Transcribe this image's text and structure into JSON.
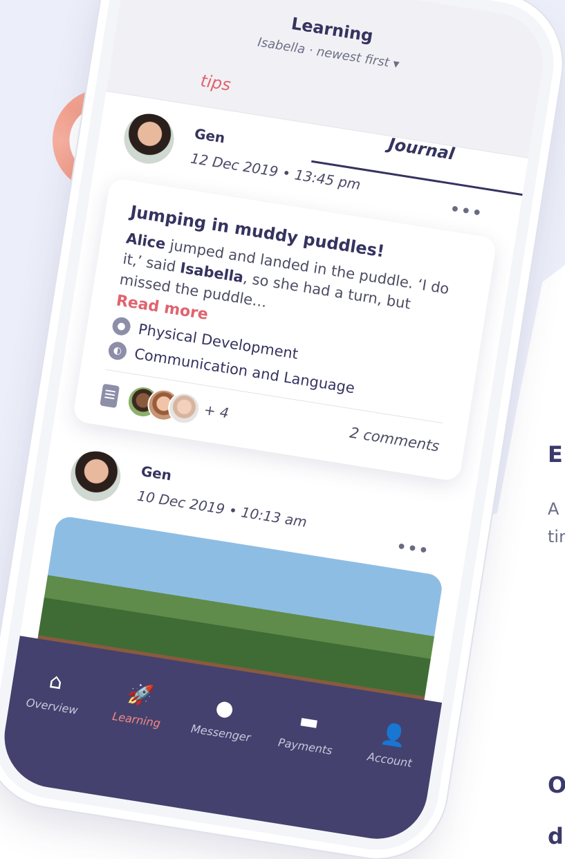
{
  "right_side": {
    "heading_fragment": "E",
    "text_line1": "A",
    "text_line2": "tin",
    "bottom_line1": "O",
    "bottom_line2": "d"
  },
  "header": {
    "title": "Learning",
    "subtitle": "Isabella · newest first ▾"
  },
  "tabs": [
    {
      "label": "tips",
      "active": false
    },
    {
      "label": "Journal",
      "active": true
    }
  ],
  "posts": [
    {
      "author": "Gen",
      "date": "12 Dec 2019 • 13:45 pm",
      "more": "•••",
      "headline": "Jumping in muddy puddles!",
      "body_prefix_bold": "Alice",
      "body_part1": " jumped and landed in the puddle. ‘I do it,’ said ",
      "body_bold2": "Isabella",
      "body_part2": ", so she had a turn, but missed the puddle…",
      "read_more": "Read more",
      "tags": [
        "Physical Development",
        "Communication and Language"
      ],
      "more_children": "+ 4",
      "comments": "2 comments"
    },
    {
      "author": "Gen",
      "date": "10 Dec 2019 • 10:13 am",
      "more": "•••"
    }
  ],
  "nav": [
    {
      "label": "Overview",
      "icon": "home-icon",
      "glyph": "⌂",
      "active": false
    },
    {
      "label": "Learning",
      "icon": "rocket-icon",
      "glyph": "🚀",
      "active": true
    },
    {
      "label": "Messenger",
      "icon": "chat-icon",
      "glyph": "●",
      "active": false
    },
    {
      "label": "Payments",
      "icon": "card-icon",
      "glyph": "▬",
      "active": false
    },
    {
      "label": "Account",
      "icon": "person-icon",
      "glyph": "👤",
      "active": false
    }
  ],
  "colors": {
    "accent": "#e0636f",
    "primary": "#35335f",
    "navbar": "#44416e",
    "active_nav": "#f48a82"
  }
}
